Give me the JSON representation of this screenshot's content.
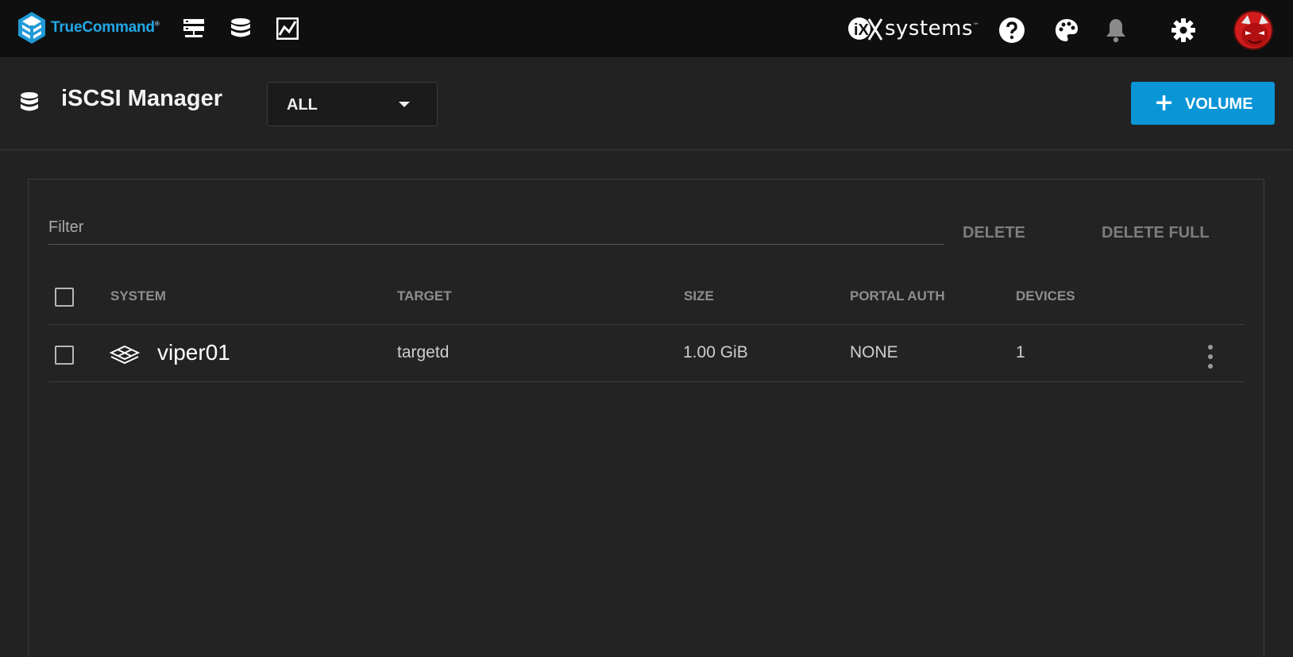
{
  "topbar": {
    "brand": "TrueCommand",
    "brand_mark": "®",
    "nav_icons": [
      "systems-icon",
      "storage-icon",
      "reports-icon"
    ],
    "partner_logo": "systems",
    "partner_prefix": "iX",
    "partner_mark": "™",
    "actions": [
      "help-icon",
      "palette-icon",
      "notifications-icon",
      "settings-icon"
    ]
  },
  "header": {
    "icon": "storage-icon",
    "title": "iSCSI Manager",
    "select_value": "ALL",
    "add_button_label": "VOLUME",
    "add_button_color": "#0a95d6"
  },
  "table": {
    "filter_placeholder": "Filter",
    "delete_label": "DELETE",
    "delete_full_label": "DELETE FULL",
    "columns": [
      "SYSTEM",
      "TARGET",
      "SIZE",
      "PORTAL AUTH",
      "DEVICES"
    ],
    "rows": [
      {
        "system": "viper01",
        "target": "targetd",
        "size": "1.00 GiB",
        "portal_auth": "NONE",
        "devices": "1",
        "selected": false
      }
    ]
  },
  "colors": {
    "accent": "#0a95d6",
    "brand": "#22a7e6",
    "topbar_bg": "#0f0f0f",
    "page_bg": "#222222"
  }
}
